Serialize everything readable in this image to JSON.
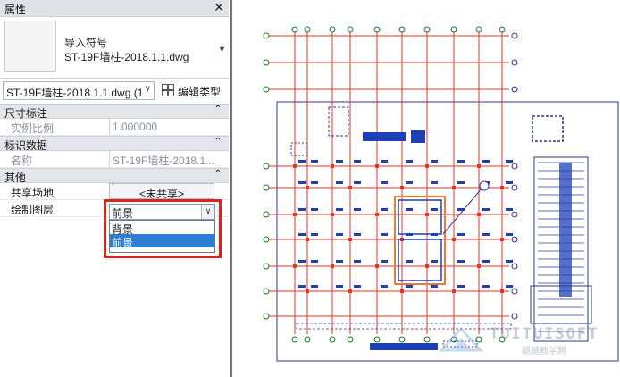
{
  "panel": {
    "title": "属性",
    "close_icon": "close-icon",
    "type_selector": {
      "line1": "导入符号",
      "line2": "ST-19F墙柱-2018.1.1.dwg"
    },
    "instance_select": {
      "value": "ST-19F墙柱-2018.1.1.dwg (1"
    },
    "edit_type_label": "编辑类型",
    "sections": {
      "dimensions": {
        "label": "尺寸标注",
        "rows": [
          {
            "key": "实例比例",
            "value": "1.000000"
          }
        ]
      },
      "identity": {
        "label": "标识数据",
        "rows": [
          {
            "key": "名称",
            "value": "ST-19F墙柱-2018.1...."
          }
        ]
      },
      "other": {
        "label": "其他",
        "shared_site": {
          "key": "共享场地",
          "value": "<未共享>"
        },
        "draw_layer": {
          "key": "绘制图层",
          "value": "前景",
          "options": [
            "背景",
            "前景"
          ],
          "selected": "前景"
        }
      }
    }
  },
  "drawing": {
    "colors": {
      "grid": "#e8322a",
      "wall": "#1d3fb8",
      "outline": "#2a3a8c",
      "bubble": "#1a7a2a",
      "highlight": "#ee7a2f"
    }
  },
  "watermark": {
    "brand": "TUITUISOFT",
    "sub": "腿腿教学网"
  }
}
